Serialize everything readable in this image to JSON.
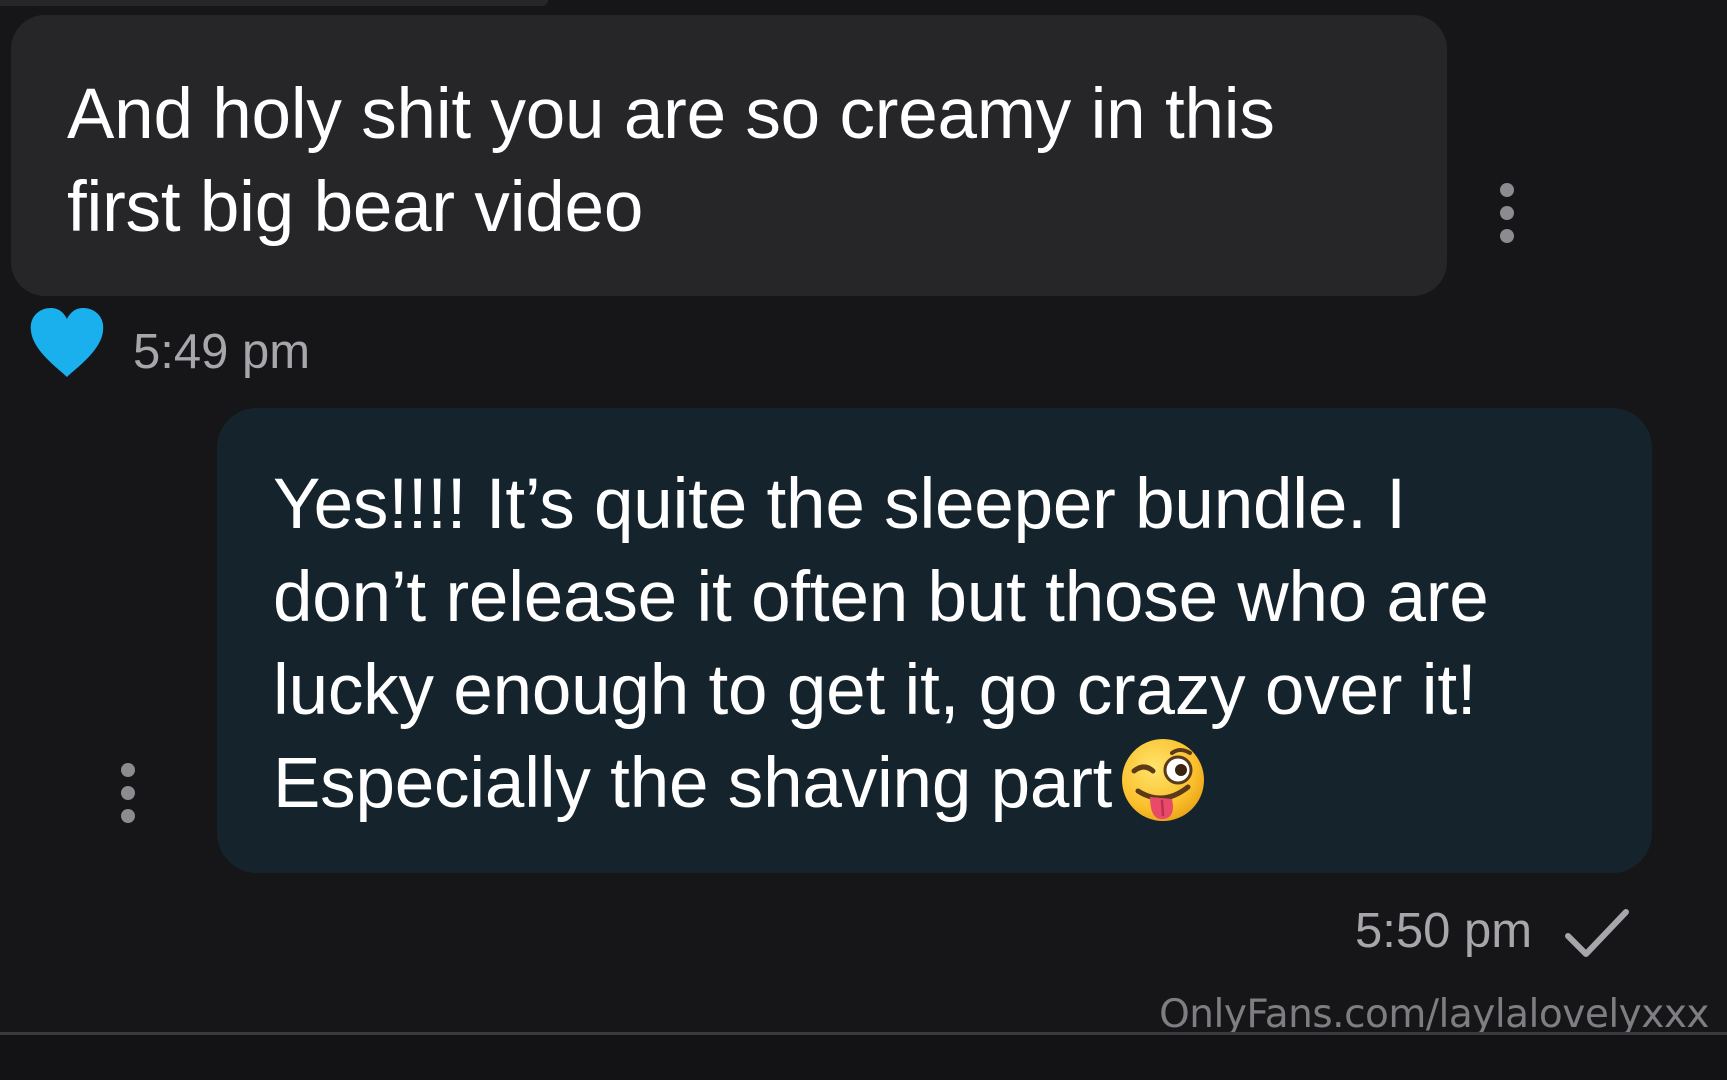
{
  "conversation": {
    "incoming_message": {
      "text": "And holy shit you are so creamy in this\nfirst big bear video",
      "time": "5:49 pm",
      "reaction_icon": "heart-icon",
      "reaction_color": "#1ab0ee"
    },
    "outgoing_message": {
      "text": "Yes!!!! It’s quite the sleeper bundle. I\ndon’t release it often but those who are\nlucky enough to get it, go crazy over it!\nEspecially the shaving part",
      "emoji": "winking-face-with-tongue",
      "time": "5:50 pm",
      "status_icon": "check-icon"
    }
  },
  "watermark": "OnlyFans.com/laylalovelyxxx",
  "colors": {
    "background": "#161618",
    "incoming_bubble": "#262629",
    "outgoing_bubble": "#15242c",
    "text": "#ffffff",
    "meta_text": "#a6a6ab",
    "accent": "#1ab0ee"
  }
}
